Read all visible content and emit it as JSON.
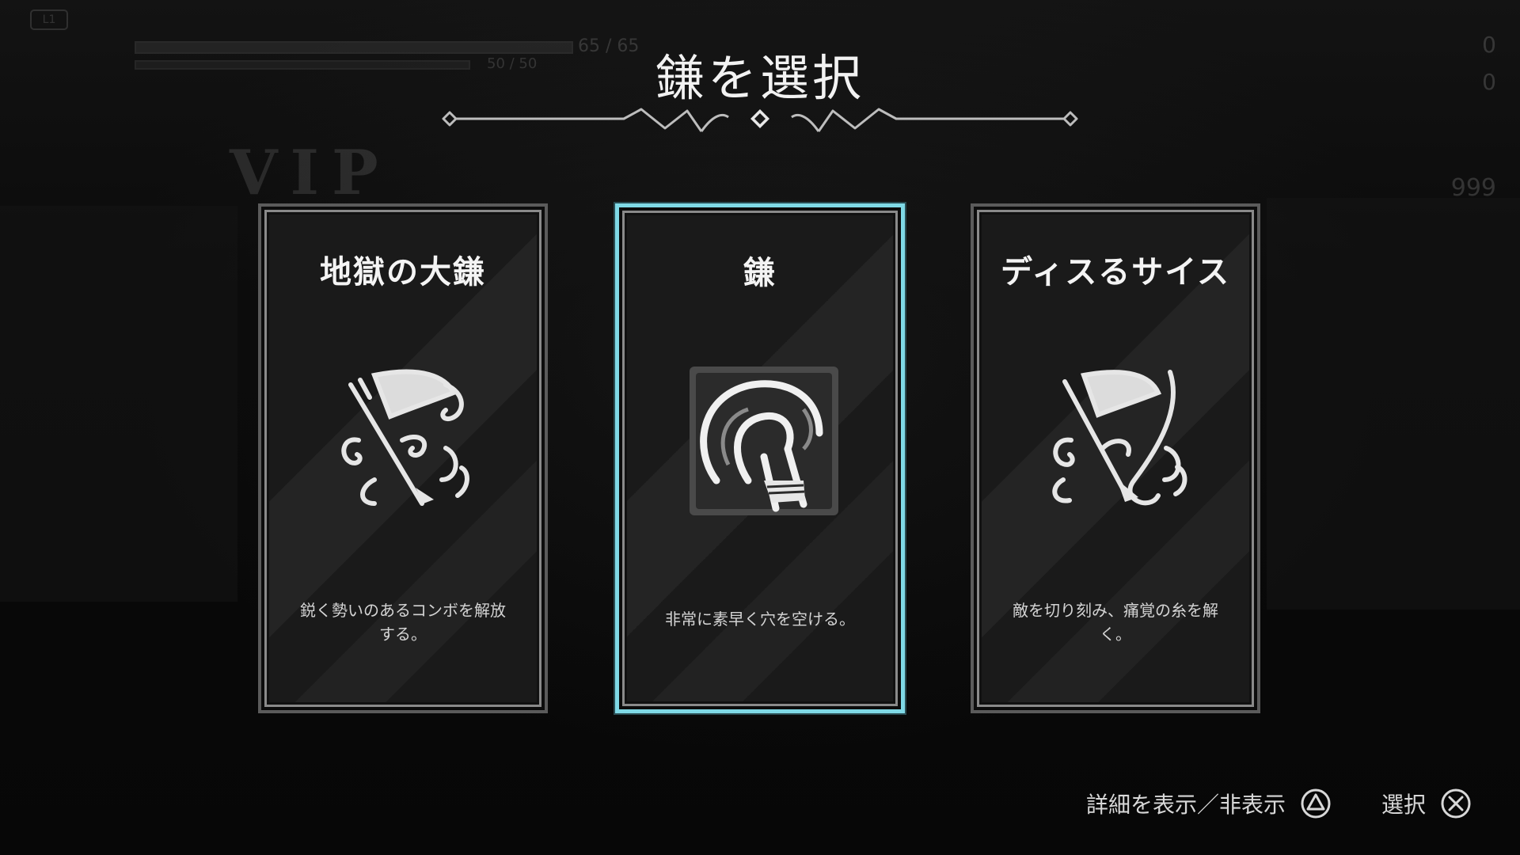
{
  "hud": {
    "l1_label": "L1",
    "hp_text": "65 / 65",
    "mp_text": "50 / 50",
    "vip_text": "VIP",
    "right_counts": [
      "0",
      "0"
    ],
    "right_number": "999"
  },
  "title": "鎌を選択",
  "cards": [
    {
      "title": "地獄の大鎌",
      "icon": "hell-scythe-icon",
      "description": "鋭く勢いのあるコンボを解放する。",
      "selected": false
    },
    {
      "title": "鎌",
      "icon": "sickle-icon",
      "description": "非常に素早く穴を空ける。",
      "selected": true
    },
    {
      "title": "ディスるサイス",
      "icon": "dissing-scythe-icon",
      "description": "敵を切り刻み、痛覚の糸を解く。",
      "selected": false
    }
  ],
  "prompts": {
    "details_label": "詳細を表示／非表示",
    "details_button": "triangle-button-icon",
    "select_label": "選択",
    "select_button": "cross-button-icon"
  },
  "colors": {
    "selected_border": "#7fd9e6",
    "card_border": "#5b5b5b",
    "background": "#0b0b0b"
  }
}
